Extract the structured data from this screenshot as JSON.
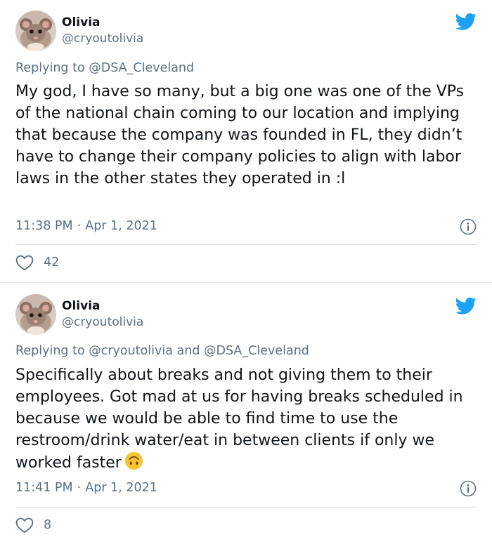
{
  "tweets": [
    {
      "display_name": "Olivia",
      "handle": "@cryoutolivia",
      "replying_prefix": "Replying to ",
      "replying_to": [
        "@DSA_Cleveland"
      ],
      "replying_joiner": "",
      "text": "My god, I have so many, but a big one was one of the VPs of the national chain coming to our location and implying that because the company was founded in FL, they didn’t have to change their company policies to align with labor laws in the other states they operated in :l",
      "time": "11:38 PM",
      "date": "Apr 1, 2021",
      "separator": "·",
      "likes": "42",
      "avatar_icon": "mouse-avatar",
      "brand_icon": "twitter-bird-icon"
    },
    {
      "display_name": "Olivia",
      "handle": "@cryoutolivia",
      "replying_prefix": "Replying to ",
      "replying_to": [
        "@cryoutolivia",
        "@DSA_Cleveland"
      ],
      "replying_joiner": " and ",
      "text": "Specifically about breaks and not giving them to their employees. Got mad at us for having breaks scheduled in because we would be able to find time to use the restroom/drink water/eat in between clients if only we worked faster",
      "emoji": "upside-down-face-emoji",
      "time": "11:41 PM",
      "date": "Apr 1, 2021",
      "separator": "·",
      "likes": "8",
      "avatar_icon": "mouse-avatar",
      "brand_icon": "twitter-bird-icon"
    }
  ],
  "colors": {
    "text": "#0f1419",
    "secondary": "#5b7083",
    "twitter_blue": "#1da1f2",
    "divider": "#cfd9de",
    "emoji": "#f7c331"
  }
}
